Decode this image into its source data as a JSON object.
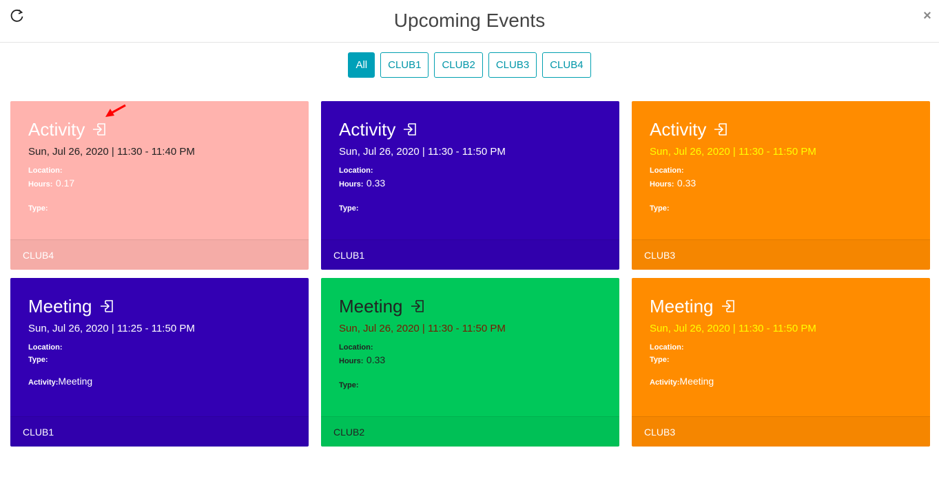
{
  "header": {
    "title": "Upcoming Events",
    "close_label": "×"
  },
  "filters": [
    {
      "label": "All",
      "active": true
    },
    {
      "label": "CLUB1",
      "active": false
    },
    {
      "label": "CLUB2",
      "active": false
    },
    {
      "label": "CLUB3",
      "active": false
    },
    {
      "label": "CLUB4",
      "active": false
    }
  ],
  "cards": [
    {
      "title": "Activity",
      "date": "Sun, Jul 26, 2020 | 11:30 - 11:40 PM",
      "location_label": "Location:",
      "hours_label": "Hours:",
      "hours_value": "0.17",
      "type_label": "Type:",
      "club": "CLUB4",
      "bg": "#ffb3ae",
      "text_color": "#ffffff",
      "date_color": "#222222"
    },
    {
      "title": "Activity",
      "date": "Sun, Jul 26, 2020 | 11:30 - 11:50 PM",
      "location_label": "Location:",
      "hours_label": "Hours:",
      "hours_value": "0.33",
      "type_label": "Type:",
      "club": "CLUB1",
      "bg": "#3300b3",
      "text_color": "#ffffff",
      "date_color": "#ffffff"
    },
    {
      "title": "Activity",
      "date": "Sun, Jul 26, 2020 | 11:30 - 11:50 PM",
      "location_label": "Location:",
      "hours_label": "Hours:",
      "hours_value": "0.33",
      "type_label": "Type:",
      "club": "CLUB3",
      "bg": "#ff8c00",
      "text_color": "#ffffff",
      "date_color": "#ffff00"
    },
    {
      "title": "Meeting",
      "date": "Sun, Jul 26, 2020 | 11:25 - 11:50 PM",
      "location_label": "Location:",
      "type_label": "Type:",
      "activity_label": "Activity:",
      "activity_value": "Meeting",
      "club": "CLUB1",
      "bg": "#3300b3",
      "text_color": "#ffffff",
      "date_color": "#ffffff"
    },
    {
      "title": "Meeting",
      "date": "Sun, Jul 26, 2020 | 11:30 - 11:50 PM",
      "location_label": "Location:",
      "hours_label": "Hours:",
      "hours_value": "0.33",
      "type_label": "Type:",
      "club": "CLUB2",
      "bg": "#00c85a",
      "text_color": "#222222",
      "date_color": "#7a1a00"
    },
    {
      "title": "Meeting",
      "date": "Sun, Jul 26, 2020 | 11:30 - 11:50 PM",
      "location_label": "Location:",
      "type_label": "Type:",
      "activity_label": "Activity:",
      "activity_value": "Meeting",
      "club": "CLUB3",
      "bg": "#ff8c00",
      "text_color": "#ffffff",
      "date_color": "#ffff00"
    }
  ],
  "icons": {
    "refresh": "refresh-icon",
    "close": "close-icon",
    "enter": "enter-icon",
    "annotation": "red-arrow-icon"
  },
  "colors": {
    "accent": "#00a0b8",
    "annotation": "#ff0000"
  }
}
